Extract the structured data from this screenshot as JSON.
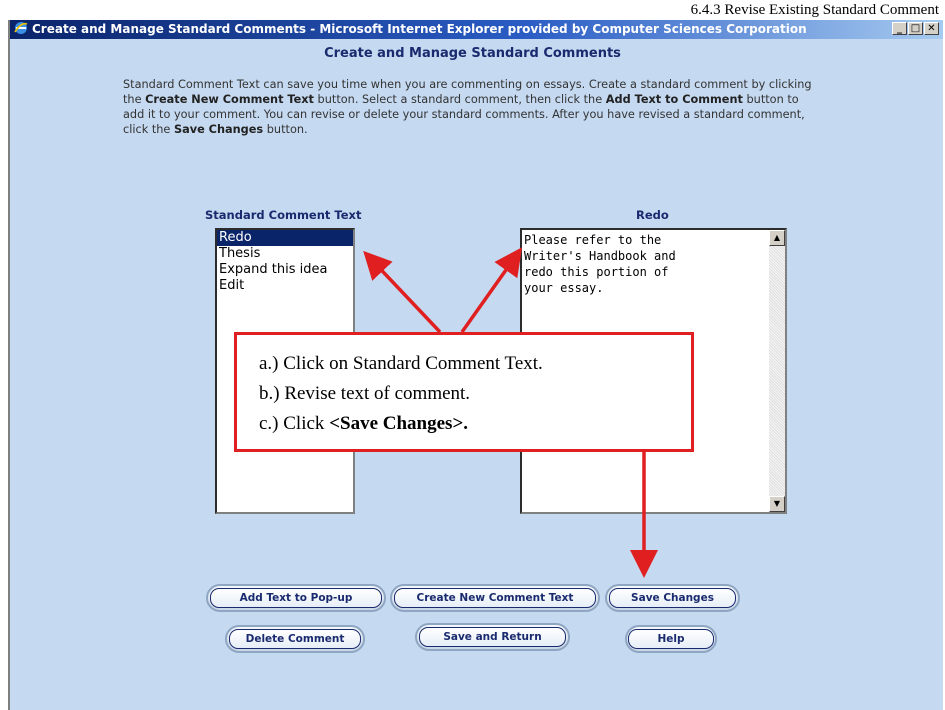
{
  "doc_header": "6.4.3 Revise Existing Standard Comment",
  "window": {
    "title": "Create and Manage Standard Comments - Microsoft Internet Explorer provided by Computer Sciences Corporation",
    "minimize": "_",
    "maximize": "□",
    "close": "✕"
  },
  "page": {
    "title": "Create and Manage Standard Comments",
    "intro": [
      "Standard Comment Text can save you time when you are commenting on essays. Create a standard comment by clicking the ",
      "Create New Comment Text",
      " button. Select a standard comment, then click the ",
      "Add Text to Comment",
      " button to add it to your comment. You can revise or delete your standard comments. After you have revised a standard comment, click the ",
      "Save Changes",
      " button."
    ]
  },
  "list": {
    "header": "Standard Comment Text",
    "items": [
      "Redo",
      "Thesis",
      "Expand this idea",
      "Edit"
    ],
    "selected_index": 0
  },
  "editor": {
    "header": "Redo",
    "text_lines": [
      "Please refer to the",
      "Writer's Handbook and",
      "redo this portion of",
      "your essay."
    ]
  },
  "buttons": {
    "add_text_popup": "Add Text to Pop-up",
    "create_new": "Create New Comment Text",
    "save_changes": "Save Changes",
    "delete_comment": "Delete Comment",
    "save_return": "Save and Return",
    "help": "Help"
  },
  "callout": {
    "line_a": "a.)  Click on Standard Comment Text.",
    "line_b": "b.)  Revise text of comment.",
    "line_c_prefix": "c.)  Click ",
    "line_c_bold": "<Save Changes>."
  },
  "colors": {
    "page_bg": "#c5d9f1",
    "accent_text": "#1a2a6e",
    "arrow_red": "#e02020",
    "selection": "#0a246a"
  }
}
